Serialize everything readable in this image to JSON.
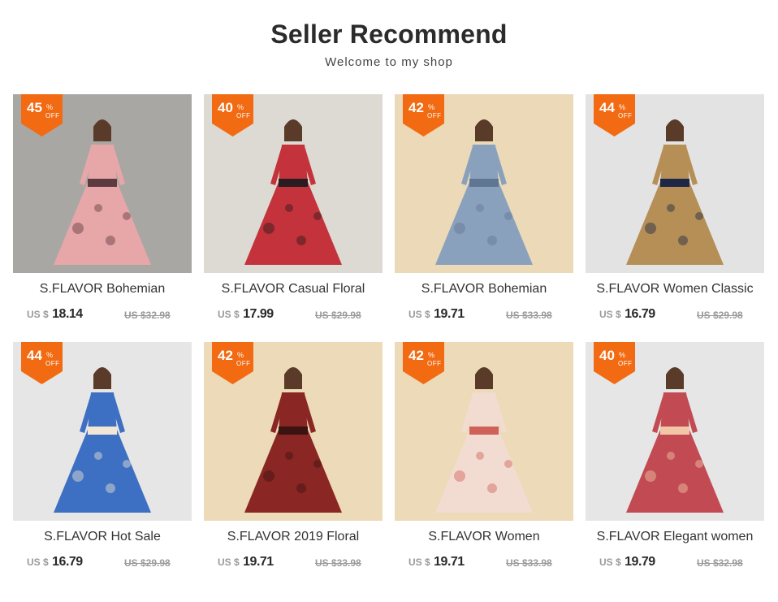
{
  "header": {
    "title": "Seller Recommend",
    "subtitle": "Welcome to my shop"
  },
  "badge": {
    "percent_sign": "%",
    "off_label": "OFF"
  },
  "products": [
    {
      "name": "S.FLAVOR Bohemian",
      "discount": "45",
      "currency": "US $",
      "price": "18.14",
      "old_price": "US $32.98",
      "bg": "#a9a7a4",
      "dress": "#e7a7a8",
      "accent": "#5d3a3f"
    },
    {
      "name": "S.FLAVOR Casual Floral",
      "discount": "40",
      "currency": "US $",
      "price": "17.99",
      "old_price": "US $29.98",
      "bg": "#ddd9d3",
      "dress": "#c4323b",
      "accent": "#2a1c20"
    },
    {
      "name": "S.FLAVOR Bohemian",
      "discount": "42",
      "currency": "US $",
      "price": "19.71",
      "old_price": "US $33.98",
      "bg": "#ebd9b8",
      "dress": "#8aa1bd",
      "accent": "#5f7592"
    },
    {
      "name": "S.FLAVOR Women Classic",
      "discount": "44",
      "currency": "US $",
      "price": "16.79",
      "old_price": "US $29.98",
      "bg": "#e3e3e3",
      "dress": "#b58f55",
      "accent": "#1f2747"
    },
    {
      "name": "S.FLAVOR Hot Sale",
      "discount": "44",
      "currency": "US $",
      "price": "16.79",
      "old_price": "US $29.98",
      "bg": "#e6e6e6",
      "dress": "#3d6fc2",
      "accent": "#f2e6d5"
    },
    {
      "name": "S.FLAVOR 2019 Floral",
      "discount": "42",
      "currency": "US $",
      "price": "19.71",
      "old_price": "US $33.98",
      "bg": "#ecdab8",
      "dress": "#8a2623",
      "accent": "#3b1412"
    },
    {
      "name": "S.FLAVOR Women",
      "discount": "42",
      "currency": "US $",
      "price": "19.71",
      "old_price": "US $33.98",
      "bg": "#ecdab8",
      "dress": "#f2dcd2",
      "accent": "#d0605a"
    },
    {
      "name": "S.FLAVOR Elegant women",
      "discount": "40",
      "currency": "US $",
      "price": "19.79",
      "old_price": "US $32.98",
      "bg": "#e6e6e6",
      "dress": "#c24b53",
      "accent": "#f1c7a8"
    }
  ],
  "colors": {
    "badge": "#f26a12",
    "title": "#2b2b2b",
    "strike": "#9a9a9a"
  }
}
